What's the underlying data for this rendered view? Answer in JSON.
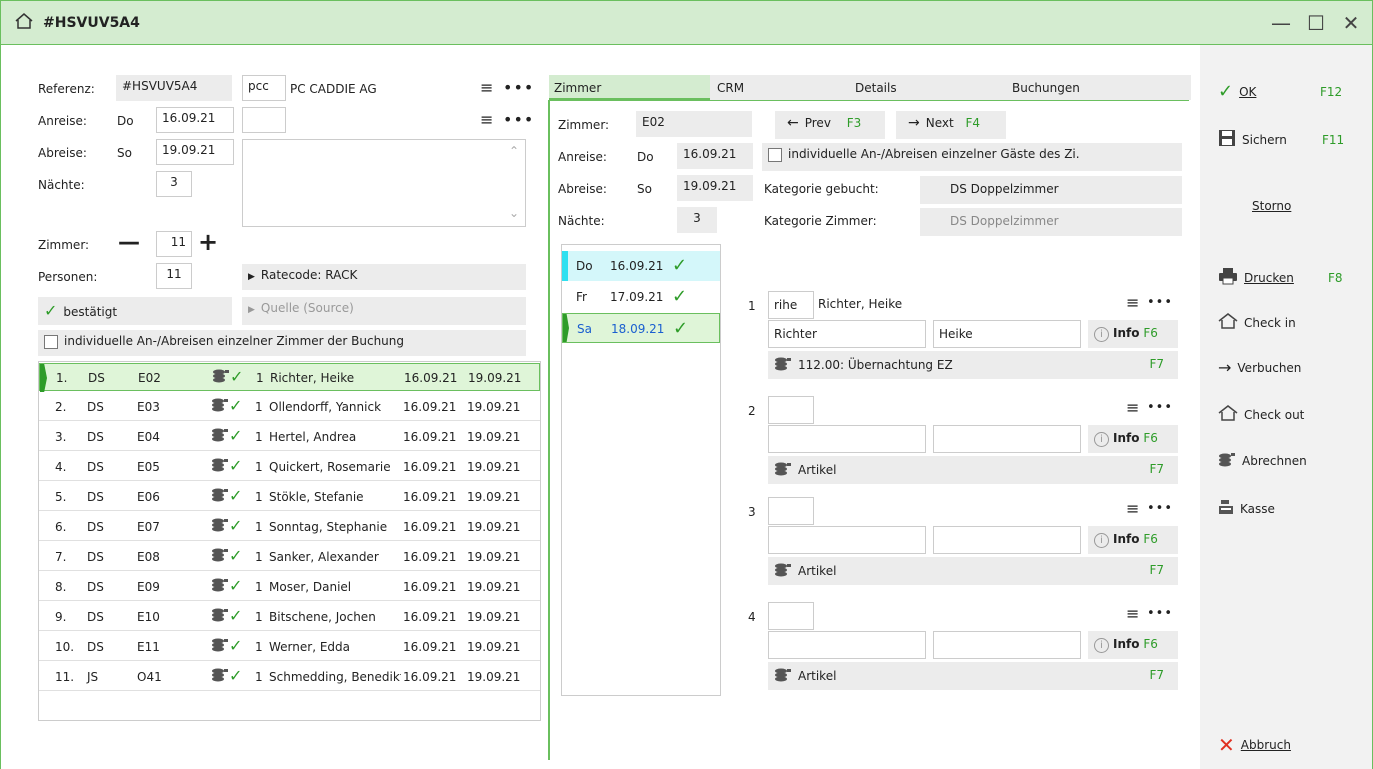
{
  "window": {
    "title": "#HSVUV5A4"
  },
  "booking": {
    "referenz_label": "Referenz:",
    "referenz": "#HSVUV5A4",
    "company_code": "pcc",
    "company_name": "PC CADDIE AG",
    "anreise_label": "Anreise:",
    "anreise_day": "Do",
    "anreise_date": "16.09.21",
    "abreise_label": "Abreise:",
    "abreise_day": "So",
    "abreise_date": "19.09.21",
    "naechte_label": "Nächte:",
    "naechte": "3",
    "zimmer_label": "Zimmer:",
    "zimmer_count": "11",
    "personen_label": "Personen:",
    "personen": "11",
    "ratecode": "Ratecode: RACK",
    "status": "bestätigt",
    "quelle": "Quelle (Source)",
    "individual_rooms_label": "individuelle An-/Abreisen einzelner Zimmer der Buchung"
  },
  "rooms": [
    {
      "no": "1.",
      "cat": "DS",
      "room": "E02",
      "qty": "1",
      "name": "Richter, Heike",
      "from": "16.09.21",
      "to": "19.09.21"
    },
    {
      "no": "2.",
      "cat": "DS",
      "room": "E03",
      "qty": "1",
      "name": "Ollendorff, Yannick",
      "from": "16.09.21",
      "to": "19.09.21"
    },
    {
      "no": "3.",
      "cat": "DS",
      "room": "E04",
      "qty": "1",
      "name": "Hertel, Andrea",
      "from": "16.09.21",
      "to": "19.09.21"
    },
    {
      "no": "4.",
      "cat": "DS",
      "room": "E05",
      "qty": "1",
      "name": "Quickert, Rosemarie",
      "from": "16.09.21",
      "to": "19.09.21"
    },
    {
      "no": "5.",
      "cat": "DS",
      "room": "E06",
      "qty": "1",
      "name": "Stökle, Stefanie",
      "from": "16.09.21",
      "to": "19.09.21"
    },
    {
      "no": "6.",
      "cat": "DS",
      "room": "E07",
      "qty": "1",
      "name": "Sonntag, Stephanie",
      "from": "16.09.21",
      "to": "19.09.21"
    },
    {
      "no": "7.",
      "cat": "DS",
      "room": "E08",
      "qty": "1",
      "name": "Sanker, Alexander",
      "from": "16.09.21",
      "to": "19.09.21"
    },
    {
      "no": "8.",
      "cat": "DS",
      "room": "E09",
      "qty": "1",
      "name": "Moser, Daniel",
      "from": "16.09.21",
      "to": "19.09.21"
    },
    {
      "no": "9.",
      "cat": "DS",
      "room": "E10",
      "qty": "1",
      "name": "Bitschene, Jochen",
      "from": "16.09.21",
      "to": "19.09.21"
    },
    {
      "no": "10.",
      "cat": "DS",
      "room": "E11",
      "qty": "1",
      "name": "Werner, Edda",
      "from": "16.09.21",
      "to": "19.09.21"
    },
    {
      "no": "11.",
      "cat": "JS",
      "room": "O41",
      "qty": "1",
      "name": "Schmedding, Benedikt",
      "from": "16.09.21",
      "to": "19.09.21"
    }
  ],
  "tabs": [
    "Zimmer",
    "CRM",
    "Details",
    "Buchungen"
  ],
  "room_detail": {
    "zimmer_label": "Zimmer:",
    "zimmer": "E02",
    "prev": "Prev",
    "prev_key": "F3",
    "next": "Next",
    "next_key": "F4",
    "anreise_label": "Anreise:",
    "anreise_day": "Do",
    "anreise_date": "16.09.21",
    "abreise_label": "Abreise:",
    "abreise_day": "So",
    "abreise_date": "19.09.21",
    "naechte_label": "Nächte:",
    "naechte": "3",
    "individual_guests_label": "individuelle An-/Abreisen einzelner Gäste des Zi.",
    "kat_gebucht_label": "Kategorie gebucht:",
    "kat_gebucht": "DS Doppelzimmer",
    "kat_zimmer_label": "Kategorie Zimmer:",
    "kat_zimmer": "DS Doppelzimmer"
  },
  "nights": [
    {
      "day": "Do",
      "date": "16.09.21"
    },
    {
      "day": "Fr",
      "date": "17.09.21"
    },
    {
      "day": "Sa",
      "date": "18.09.21"
    }
  ],
  "guests": [
    {
      "no": "1",
      "code": "rihe",
      "display": "Richter, Heike",
      "last": "Richter",
      "first": "Heike",
      "info": "Info",
      "info_key": "F6",
      "article": "112.00: Übernachtung EZ",
      "article_key": "F7"
    },
    {
      "no": "2",
      "code": "",
      "display": "",
      "last": "",
      "first": "",
      "info": "Info",
      "info_key": "F6",
      "article": "Artikel",
      "article_key": "F7"
    },
    {
      "no": "3",
      "code": "",
      "display": "",
      "last": "",
      "first": "",
      "info": "Info",
      "info_key": "F6",
      "article": "Artikel",
      "article_key": "F7"
    },
    {
      "no": "4",
      "code": "",
      "display": "",
      "last": "",
      "first": "",
      "info": "Info",
      "info_key": "F6",
      "article": "Artikel",
      "article_key": "F7"
    }
  ],
  "sidebar": {
    "ok": "OK",
    "ok_key": "F12",
    "sichern": "Sichern",
    "sichern_key": "F11",
    "storno": "Storno",
    "drucken": "Drucken",
    "drucken_key": "F8",
    "checkin": "Check in",
    "verbuchen": "Verbuchen",
    "checkout": "Check out",
    "abrechnen": "Abrechnen",
    "kasse": "Kasse",
    "abbruch": "Abbruch"
  },
  "colors": {
    "accent": "#2e9c29",
    "highlight": "#d4ecd0",
    "cyan": "#2fe0f0"
  }
}
